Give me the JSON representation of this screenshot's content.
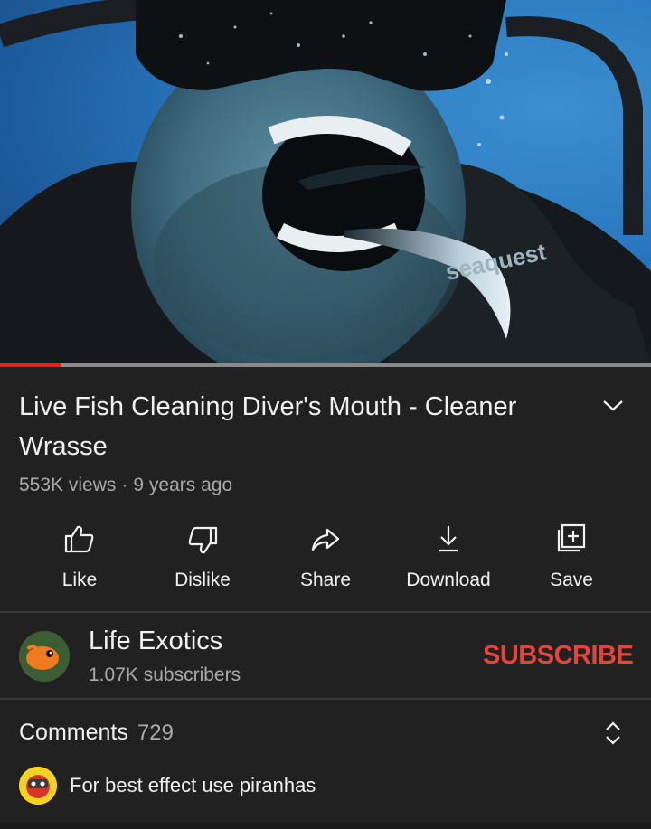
{
  "video": {
    "scene": "underwater diver with cleaner wrasse in mouth",
    "gear_text": "seaquest",
    "progress": 0.093
  },
  "title": "Live Fish Cleaning Diver's Mouth - Cleaner Wrasse",
  "meta": {
    "views": "553K views",
    "separator": "·",
    "age": "9 years ago"
  },
  "actions": [
    {
      "label": "Like",
      "icon": "thumbs-up-icon"
    },
    {
      "label": "Dislike",
      "icon": "thumbs-down-icon"
    },
    {
      "label": "Share",
      "icon": "share-arrow-icon"
    },
    {
      "label": "Download",
      "icon": "download-icon"
    },
    {
      "label": "Save",
      "icon": "save-playlist-icon"
    }
  ],
  "channel": {
    "name": "Life Exotics",
    "subscribers": "1.07K subscribers",
    "subscribe_label": "SUBSCRIBE"
  },
  "comments": {
    "heading": "Comments",
    "count": "729",
    "top_comment": "For best effect use piranhas"
  },
  "colors": {
    "background": "#212121",
    "accent_red": "#e5443a",
    "progress_red": "#e62117",
    "muted_text": "#aaaaaa"
  }
}
